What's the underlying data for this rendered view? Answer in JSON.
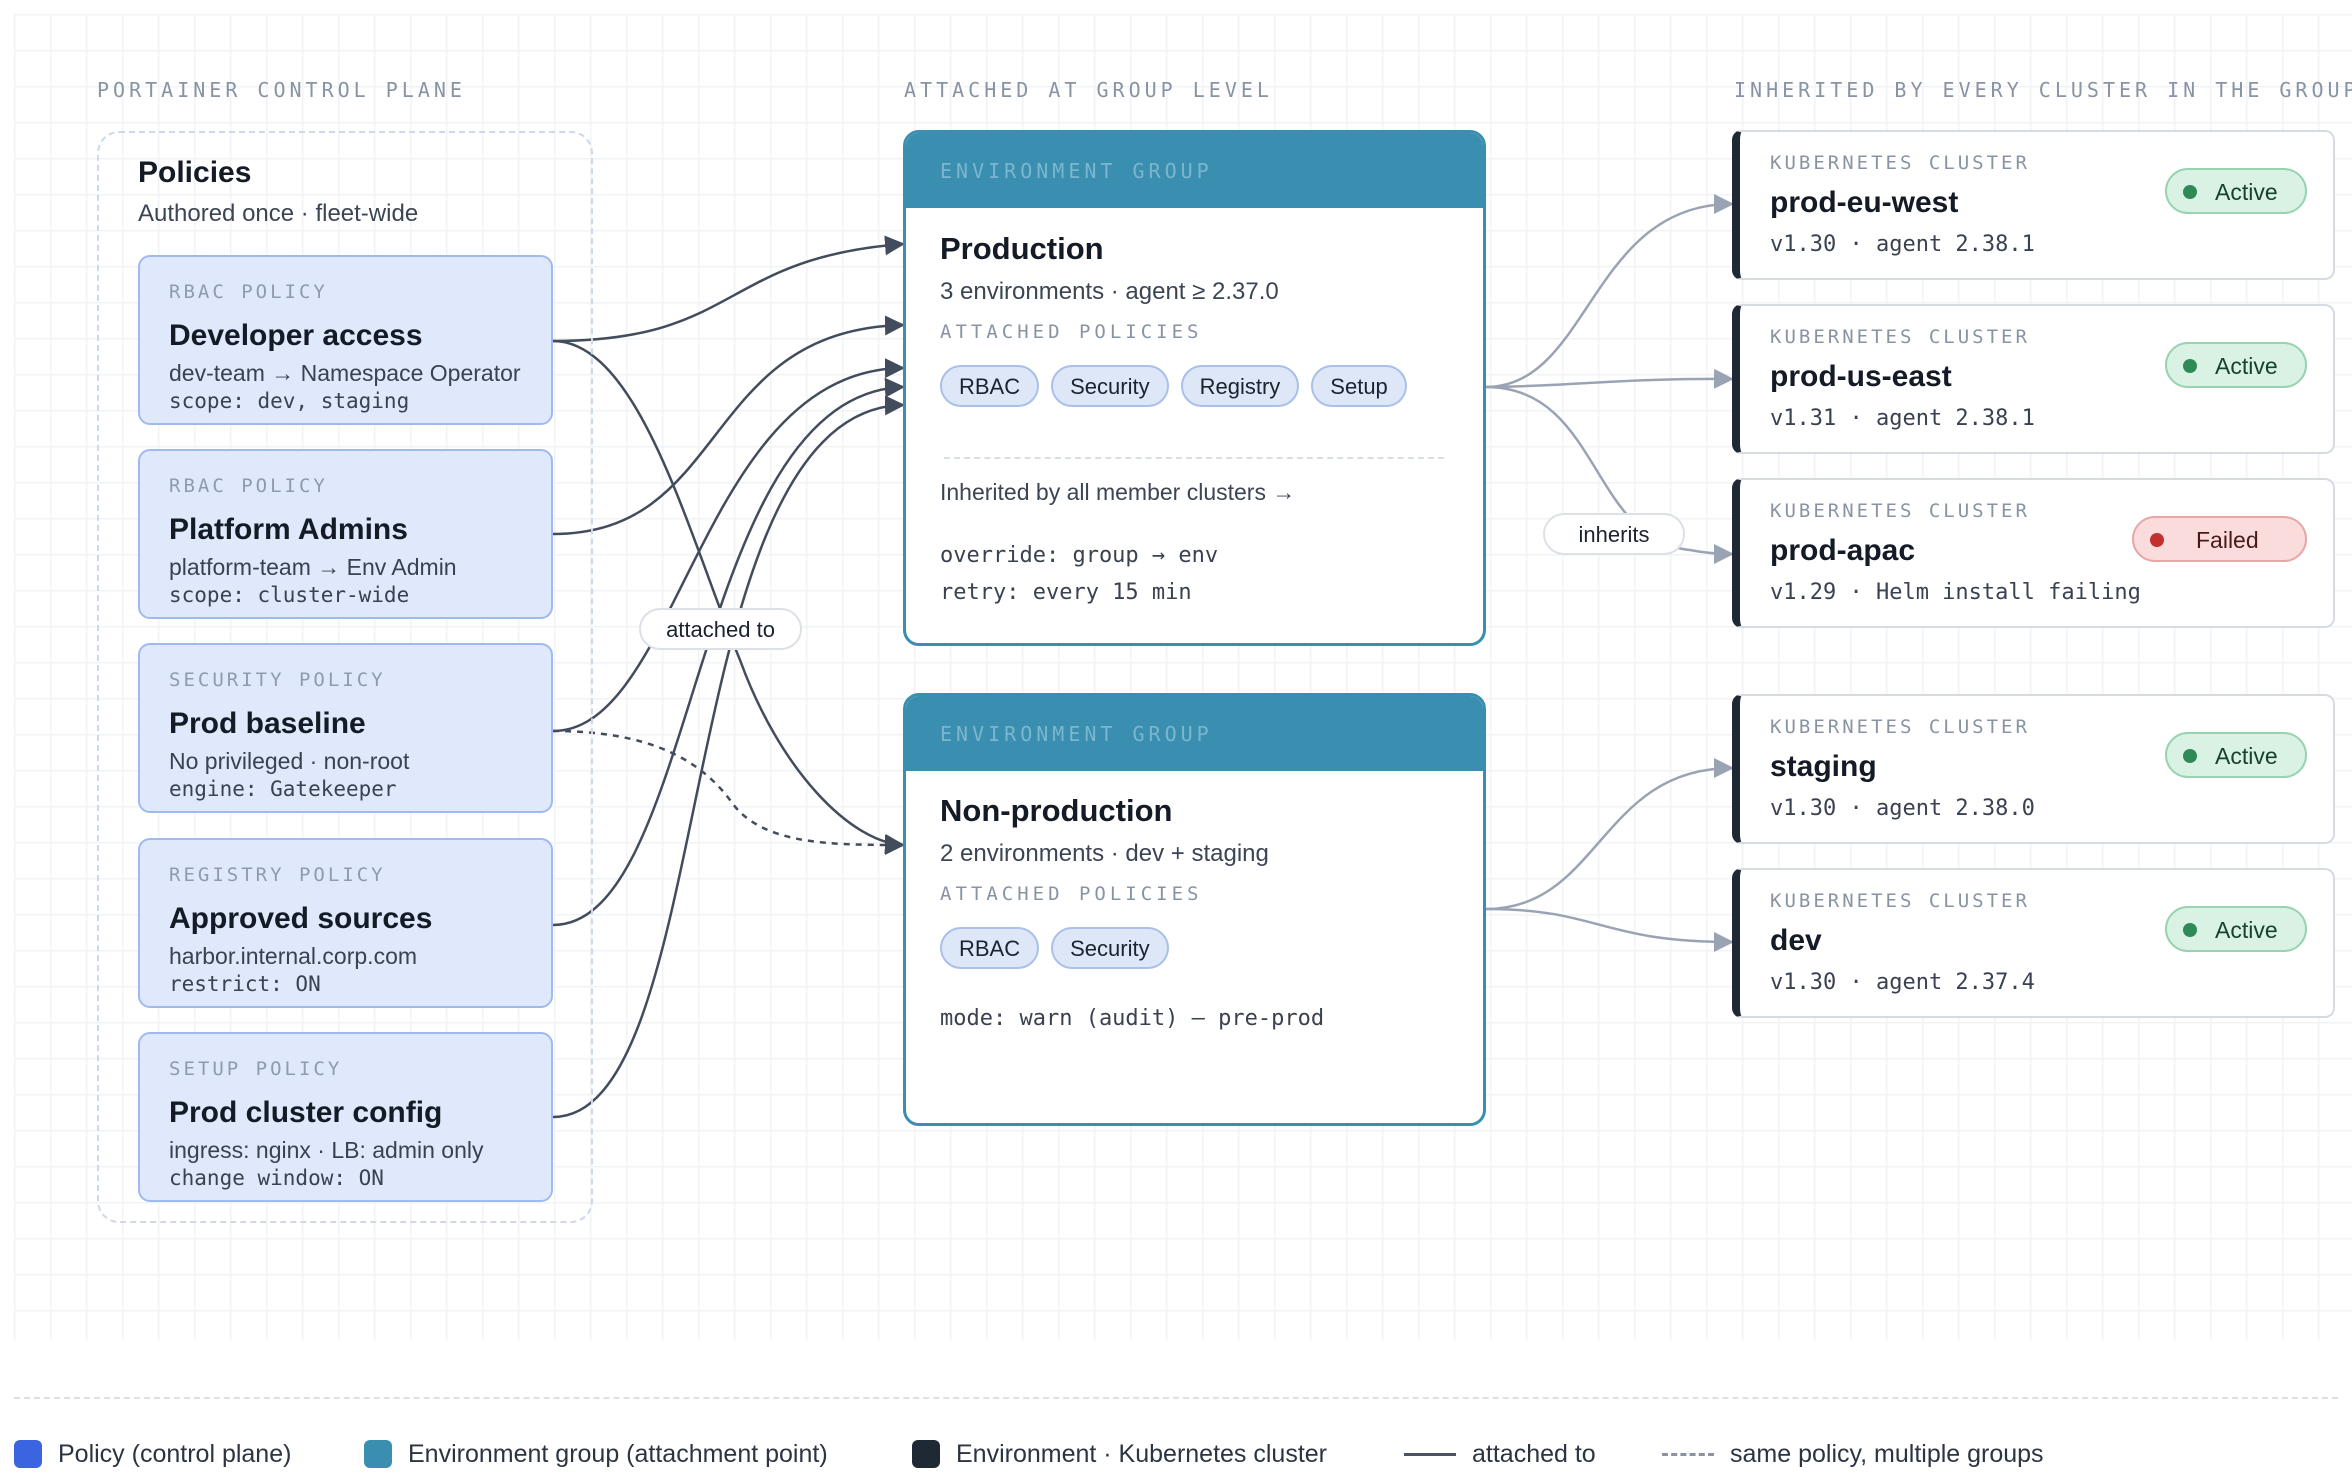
{
  "columns": {
    "control_plane": "PORTAINER CONTROL PLANE",
    "group_level": "ATTACHED AT GROUP LEVEL",
    "inherited": "INHERITED BY EVERY CLUSTER IN THE GROUP"
  },
  "policies_panel": {
    "title": "Policies",
    "subtitle": "Authored once · fleet-wide"
  },
  "policies": [
    {
      "kind": "RBAC POLICY",
      "name": "Developer access",
      "desc": "dev-team → Namespace Operator",
      "detail": "scope: dev, staging"
    },
    {
      "kind": "RBAC POLICY",
      "name": "Platform Admins",
      "desc": "platform-team → Env Admin",
      "detail": "scope: cluster-wide"
    },
    {
      "kind": "SECURITY POLICY",
      "name": "Prod baseline",
      "desc": "No privileged · non-root",
      "detail": "engine: Gatekeeper"
    },
    {
      "kind": "REGISTRY POLICY",
      "name": "Approved sources",
      "desc": "harbor.internal.corp.com",
      "detail": "restrict: ON"
    },
    {
      "kind": "SETUP POLICY",
      "name": "Prod cluster config",
      "desc": "ingress: nginx · LB: admin only",
      "detail": "change window: ON"
    }
  ],
  "groups": [
    {
      "header": "ENVIRONMENT GROUP",
      "name": "Production",
      "subtitle": "3 environments · agent ≥ 2.37.0",
      "attached_label": "ATTACHED POLICIES",
      "chips": [
        "RBAC",
        "Security",
        "Registry",
        "Setup"
      ],
      "inherit_note": "Inherited by all member clusters →",
      "code_lines": [
        "override: group → env",
        "retry: every 15 min"
      ]
    },
    {
      "header": "ENVIRONMENT GROUP",
      "name": "Non-production",
      "subtitle": "2 environments · dev + staging",
      "attached_label": "ATTACHED POLICIES",
      "chips": [
        "RBAC",
        "Security"
      ],
      "code_lines": [
        "mode: warn (audit) — pre-prod"
      ]
    }
  ],
  "clusters": [
    {
      "kind": "KUBERNETES CLUSTER",
      "name": "prod-eu-west",
      "meta": "v1.30 · agent 2.38.1",
      "status": "Active"
    },
    {
      "kind": "KUBERNETES CLUSTER",
      "name": "prod-us-east",
      "meta": "v1.31 · agent 2.38.1",
      "status": "Active"
    },
    {
      "kind": "KUBERNETES CLUSTER",
      "name": "prod-apac",
      "meta": "v1.29 · Helm install failing",
      "status": "Failed"
    },
    {
      "kind": "KUBERNETES CLUSTER",
      "name": "staging",
      "meta": "v1.30 · agent 2.38.0",
      "status": "Active"
    },
    {
      "kind": "KUBERNETES CLUSTER",
      "name": "dev",
      "meta": "v1.30 · agent 2.37.4",
      "status": "Active"
    }
  ],
  "connector_labels": {
    "attached": "attached to",
    "inherits": "inherits"
  },
  "legend": [
    {
      "label": "Policy (control plane)",
      "color": "#3b64e0"
    },
    {
      "label": "Environment group (attachment point)",
      "color": "#3a8fb0"
    },
    {
      "label": "Environment · Kubernetes cluster",
      "color": "#1f2835"
    },
    {
      "label": "attached to",
      "color": "#4a5363"
    },
    {
      "label": "same policy, multiple groups",
      "color": "#8a93a3"
    }
  ],
  "colors": {
    "policy_fill": "#dfe9fb",
    "group_accent": "#3a8fb0",
    "cluster_accent": "#1f2835",
    "status_active": "#2e8a57",
    "status_failed": "#c0312f"
  }
}
